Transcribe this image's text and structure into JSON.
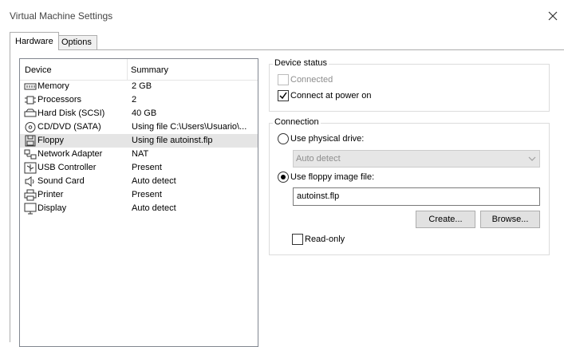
{
  "window": {
    "title": "Virtual Machine Settings",
    "close_glyph": "×"
  },
  "tabs": [
    {
      "label": "Hardware",
      "active": true
    },
    {
      "label": "Options",
      "active": false
    }
  ],
  "device_list": {
    "columns": [
      "Device",
      "Summary"
    ],
    "rows": [
      {
        "icon": "memory-icon",
        "device": "Memory",
        "summary": "2 GB"
      },
      {
        "icon": "processor-icon",
        "device": "Processors",
        "summary": "2"
      },
      {
        "icon": "hard-disk-icon",
        "device": "Hard Disk (SCSI)",
        "summary": "40 GB"
      },
      {
        "icon": "cd-dvd-icon",
        "device": "CD/DVD (SATA)",
        "summary": "Using file C:\\Users\\Usuario\\..."
      },
      {
        "icon": "floppy-icon",
        "device": "Floppy",
        "summary": "Using file autoinst.flp",
        "selected": true
      },
      {
        "icon": "network-adapter-icon",
        "device": "Network Adapter",
        "summary": "NAT"
      },
      {
        "icon": "usb-icon",
        "device": "USB Controller",
        "summary": "Present"
      },
      {
        "icon": "sound-card-icon",
        "device": "Sound Card",
        "summary": "Auto detect"
      },
      {
        "icon": "printer-icon",
        "device": "Printer",
        "summary": "Present"
      },
      {
        "icon": "display-icon",
        "device": "Display",
        "summary": "Auto detect"
      }
    ]
  },
  "device_status": {
    "title": "Device status",
    "connected": {
      "label": "Connected",
      "checked": false,
      "enabled": false
    },
    "connect_at_power_on": {
      "label": "Connect at power on",
      "checked": true,
      "enabled": true
    }
  },
  "connection": {
    "title": "Connection",
    "use_physical_drive": {
      "label": "Use physical drive:",
      "selected": false
    },
    "physical_drive_select": {
      "value": "Auto detect",
      "enabled": false
    },
    "use_floppy_image": {
      "label": "Use floppy image file:",
      "selected": true
    },
    "image_file": {
      "value": "autoinst.flp"
    },
    "create_button": "Create...",
    "browse_button": "Browse...",
    "read_only": {
      "label": "Read-only",
      "checked": false
    }
  }
}
